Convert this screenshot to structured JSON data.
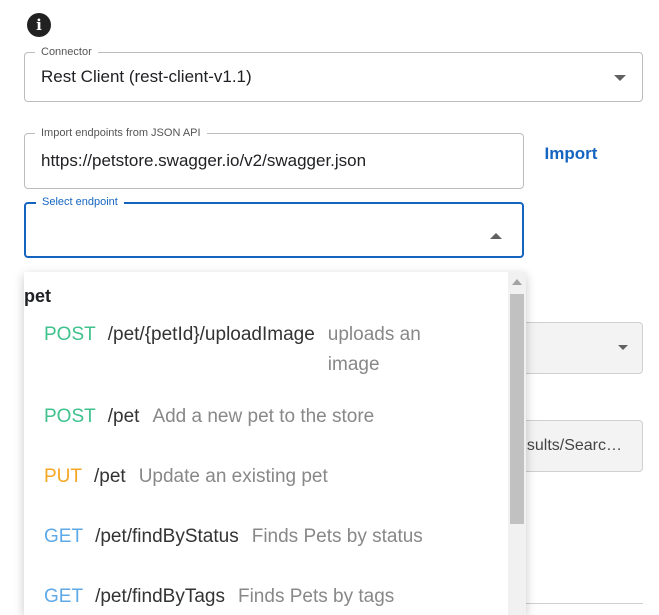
{
  "info": {
    "icon": "info-icon",
    "glyph": "i"
  },
  "connector": {
    "label": "Connector",
    "value": "Rest Client (rest-client-v1.1)"
  },
  "import": {
    "label": "Import endpoints from JSON API",
    "value": "https://petstore.swagger.io/v2/swagger.json",
    "button": "Import"
  },
  "endpoint": {
    "label": "Select endpoint",
    "value": ""
  },
  "background": {
    "path_value": "sults/Searc…"
  },
  "menu": {
    "group": "pet",
    "items": [
      {
        "method": "POST",
        "path": "/pet/{petId}/uploadImage",
        "summary": "uploads an image",
        "color": "#3fc28c"
      },
      {
        "method": "POST",
        "path": "/pet",
        "summary": "Add a new pet to the store",
        "color": "#3fc28c"
      },
      {
        "method": "PUT",
        "path": "/pet",
        "summary": "Update an existing pet",
        "color": "#f5a623"
      },
      {
        "method": "GET",
        "path": "/pet/findByStatus",
        "summary": "Finds Pets by status",
        "color": "#5ea9e6"
      },
      {
        "method": "GET",
        "path": "/pet/findByTags",
        "summary": "Finds Pets by tags",
        "color": "#5ea9e6"
      }
    ]
  },
  "colors": {
    "accent": "#1565c0",
    "post": "#3fc28c",
    "put": "#f5a623",
    "get": "#5ea9e6"
  }
}
